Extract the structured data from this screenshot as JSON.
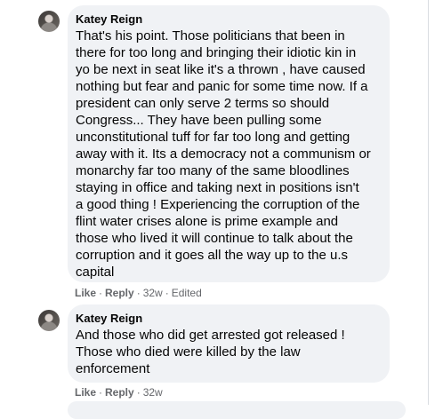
{
  "comments": [
    {
      "author": "Katey Reign",
      "text": "That's his point. Those politicians that been in\nthere for too long and bringing their idiotic kin in\nyo be next in seat like it's a thrown , have caused\nnothing but fear and panic for some time now. If a\npresident can only serve 2 terms so should\nCongress... They have been pulling some\nunconstitutional tuff for far too long and getting\naway with it. Its a democracy not a communism or\nmonarchy far too many of the same bloodlines\nstaying in office and taking next in positions isn't\na good thing ! Experiencing the corruption of the\nflint water crises alone is prime example and\nthose who lived it will continue to talk about the\ncorruption and it goes all the way up to the u.s\ncapital",
      "like": "Like",
      "reply": "Reply",
      "time": "32w",
      "edited": "Edited"
    },
    {
      "author": "Katey Reign",
      "text": "And those who did get arrested got released !\nThose who died were killed by the law\nenforcement",
      "like": "Like",
      "reply": "Reply",
      "time": "32w"
    }
  ]
}
